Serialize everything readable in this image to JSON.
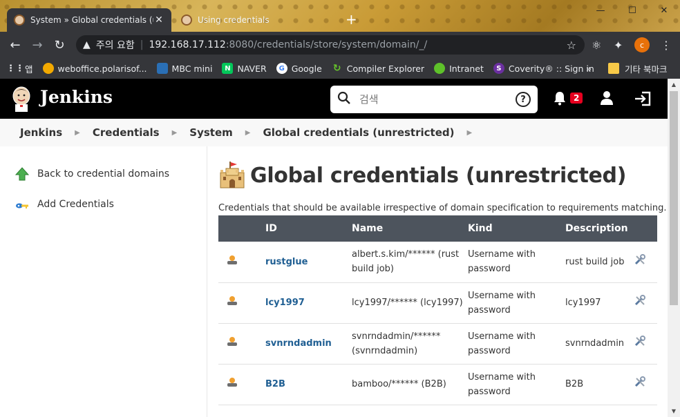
{
  "browser": {
    "tabs": [
      {
        "title": "System » Global credentials (un",
        "active": true
      },
      {
        "title": "Using credentials",
        "active": false
      }
    ],
    "address": {
      "security_label": "주의 요함",
      "host": "192.168.17.112",
      "path": ":8080/credentials/store/system/domain/_/"
    },
    "profile_initial": "c",
    "bookmarks": [
      {
        "label": "앱",
        "icon": "apps-grid-icon"
      },
      {
        "label": "weboffice.polarisof...",
        "icon": "weboffice-icon"
      },
      {
        "label": "MBC mini",
        "icon": "mbc-icon"
      },
      {
        "label": "NAVER",
        "icon": "naver-icon"
      },
      {
        "label": "Google",
        "icon": "google-icon"
      },
      {
        "label": "Compiler Explorer",
        "icon": "compiler-explorer-icon"
      },
      {
        "label": "Intranet",
        "icon": "intranet-icon"
      },
      {
        "label": "Coverity® :: Sign in",
        "icon": "coverity-icon"
      }
    ],
    "bookmarks_more": "»",
    "other_bookmarks": "기타 북마크"
  },
  "jenkins": {
    "title": "Jenkins",
    "search_placeholder": "검색",
    "help": "?",
    "notifications_count": "2",
    "breadcrumbs": [
      "Jenkins",
      "Credentials",
      "System",
      "Global credentials (unrestricted)"
    ],
    "sidebar": [
      {
        "label": "Back to credential domains",
        "icon": "up-arrow-icon"
      },
      {
        "label": "Add Credentials",
        "icon": "key-icon"
      }
    ],
    "page_title": "Global credentials (unrestricted)",
    "description": "Credentials that should be available irrespective of domain specification to requirements matching.",
    "table": {
      "headers": [
        "ID",
        "Name",
        "Kind",
        "Description"
      ],
      "rows": [
        {
          "id": "rustglue",
          "name": "albert.s.kim/****** (rust build job)",
          "kind": "Username with password",
          "description": "rust build job"
        },
        {
          "id": "lcy1997",
          "name": "lcy1997/****** (lcy1997)",
          "kind": "Username with password",
          "description": "lcy1997"
        },
        {
          "id": "svnrndadmin",
          "name": "svnrndadmin/****** (svnrndadmin)",
          "kind": "Username with password",
          "description": "svnrndadmin"
        },
        {
          "id": "B2B",
          "name": "bamboo/****** (B2B)",
          "kind": "Username with password",
          "description": "B2B"
        }
      ]
    }
  }
}
